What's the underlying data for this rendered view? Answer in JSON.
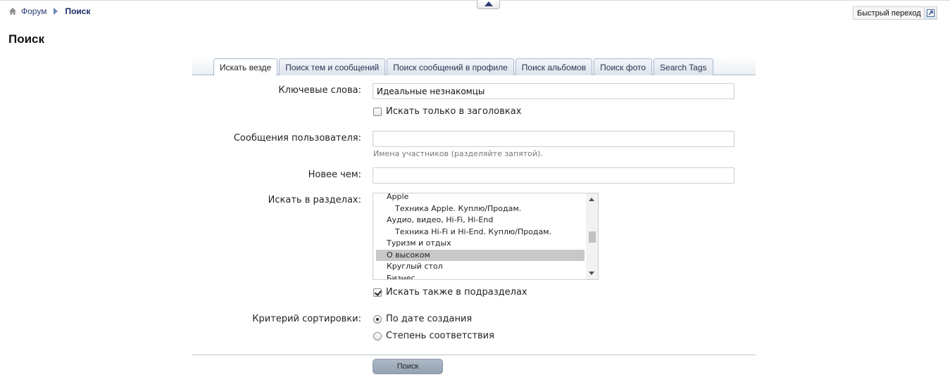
{
  "breadcrumb": {
    "home": "Форум",
    "current": "Поиск"
  },
  "quick_nav": {
    "label": "Быстрый переход"
  },
  "page_title": "Поиск",
  "tabs": [
    "Искать везде",
    "Поиск тем и сообщений",
    "Поиск сообщений в профиле",
    "Поиск альбомов",
    "Поиск фото",
    "Search Tags"
  ],
  "form": {
    "keywords_label": "Ключевые слова:",
    "keywords_value": "Идеальные незнакомцы",
    "titles_only_label": "Искать только в заголовках",
    "user_label": "Сообщения пользователя:",
    "user_hint": "Имена участников (разделяйте запятой).",
    "newer_label": "Новее чем:",
    "sections_label": "Искать в разделах:",
    "sections": [
      {
        "label": "Apple",
        "child": false
      },
      {
        "label": "Техника Apple. Куплю/Продам.",
        "child": true
      },
      {
        "label": "Аудио, видео, Hi-Fi, Hi-End",
        "child": false
      },
      {
        "label": "Техника Hi-Fi и Hi-End. Куплю/Продам.",
        "child": true
      },
      {
        "label": "Туризм и отдых",
        "child": false
      },
      {
        "label": "О высоком",
        "child": false,
        "selected": true
      },
      {
        "label": "Круглый стол",
        "child": false
      },
      {
        "label": "Бизнес",
        "child": false
      }
    ],
    "subsections_label": "Искать также в подразделах",
    "subsections_checked": true,
    "sort_label": "Критерий сортировки:",
    "sort_options": [
      "По дате создания",
      "Степень соответствия"
    ],
    "search_button": "Поиск"
  },
  "colors": {
    "link": "#2d3c78",
    "tab_border": "#a9b8cd",
    "button": "#a3afbd"
  }
}
